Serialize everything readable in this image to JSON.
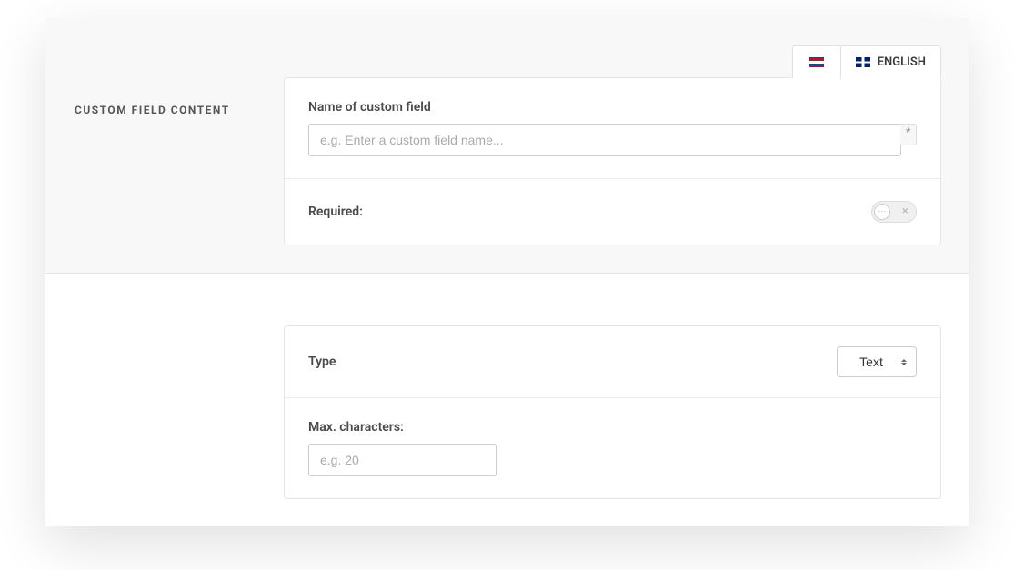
{
  "langs": {
    "nl": {
      "label": ""
    },
    "en": {
      "label": "ENGLISH"
    }
  },
  "section_title": "CUSTOM FIELD CONTENT",
  "fields": {
    "name": {
      "label": "Name of custom field",
      "placeholder": "e.g. Enter a custom field name...",
      "required_marker": "*"
    },
    "required": {
      "label": "Required:",
      "value": false
    },
    "type": {
      "label": "Type",
      "value": "Text"
    },
    "max_chars": {
      "label": "Max. characters:",
      "placeholder": "e.g. 20"
    }
  }
}
